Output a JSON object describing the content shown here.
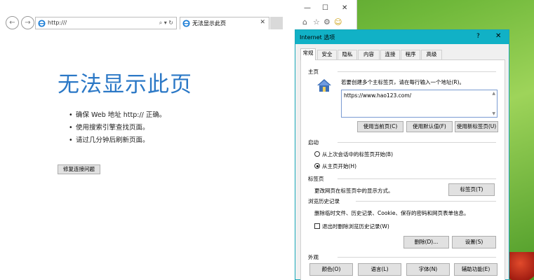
{
  "browser": {
    "window_controls": {
      "minimize": "—",
      "maximize": "☐",
      "close": "✕"
    },
    "nav": {
      "back": "←",
      "forward": "→"
    },
    "address": {
      "url": "http:///",
      "icons": "⌕ ▾ ↻"
    },
    "tab": {
      "label": "无法显示此页",
      "close": "✕"
    },
    "right_icons": {
      "home": "⌂",
      "favorites": "☆",
      "settings": "⚙",
      "smiley": "☺"
    },
    "error": {
      "title": "无法显示此页",
      "items": [
        "确保 Web 地址 http:// 正确。",
        "使用搜索引擎查找页面。",
        "请过几分钟后刷新页面。"
      ],
      "fix_button": "修复连接问题"
    }
  },
  "dialog": {
    "title": "Internet 选项",
    "help": "?",
    "close": "✕",
    "tabs": [
      "常规",
      "安全",
      "隐私",
      "内容",
      "连接",
      "程序",
      "高级"
    ],
    "home": {
      "section": "主页",
      "instruction": "若要创建多个主标签页，请在每行输入一个地址(R)。",
      "value": "https://www.hao123.com/",
      "buttons": [
        "使用当前页(C)",
        "使用默认值(F)",
        "使用新标签页(U)"
      ]
    },
    "startup": {
      "section": "启动",
      "options": [
        "从上次会话中的标签页开始(B)",
        "从主页开始(H)"
      ],
      "selected_index": 1
    },
    "tabs_section": {
      "section": "标签页",
      "text": "更改网页在标签页中的显示方式。",
      "button": "标签页(T)"
    },
    "history": {
      "section": "浏览历史记录",
      "text": "删除临时文件、历史记录、Cookie、保存的密码和网页表单信息。",
      "checkbox": "退出时删除浏览历史记录(W)",
      "checked": false,
      "buttons": [
        "删除(D)...",
        "设置(S)"
      ]
    },
    "appearance": {
      "section": "外观",
      "buttons": [
        "颜色(O)",
        "语言(L)",
        "字体(N)",
        "辅助功能(E)"
      ]
    }
  }
}
